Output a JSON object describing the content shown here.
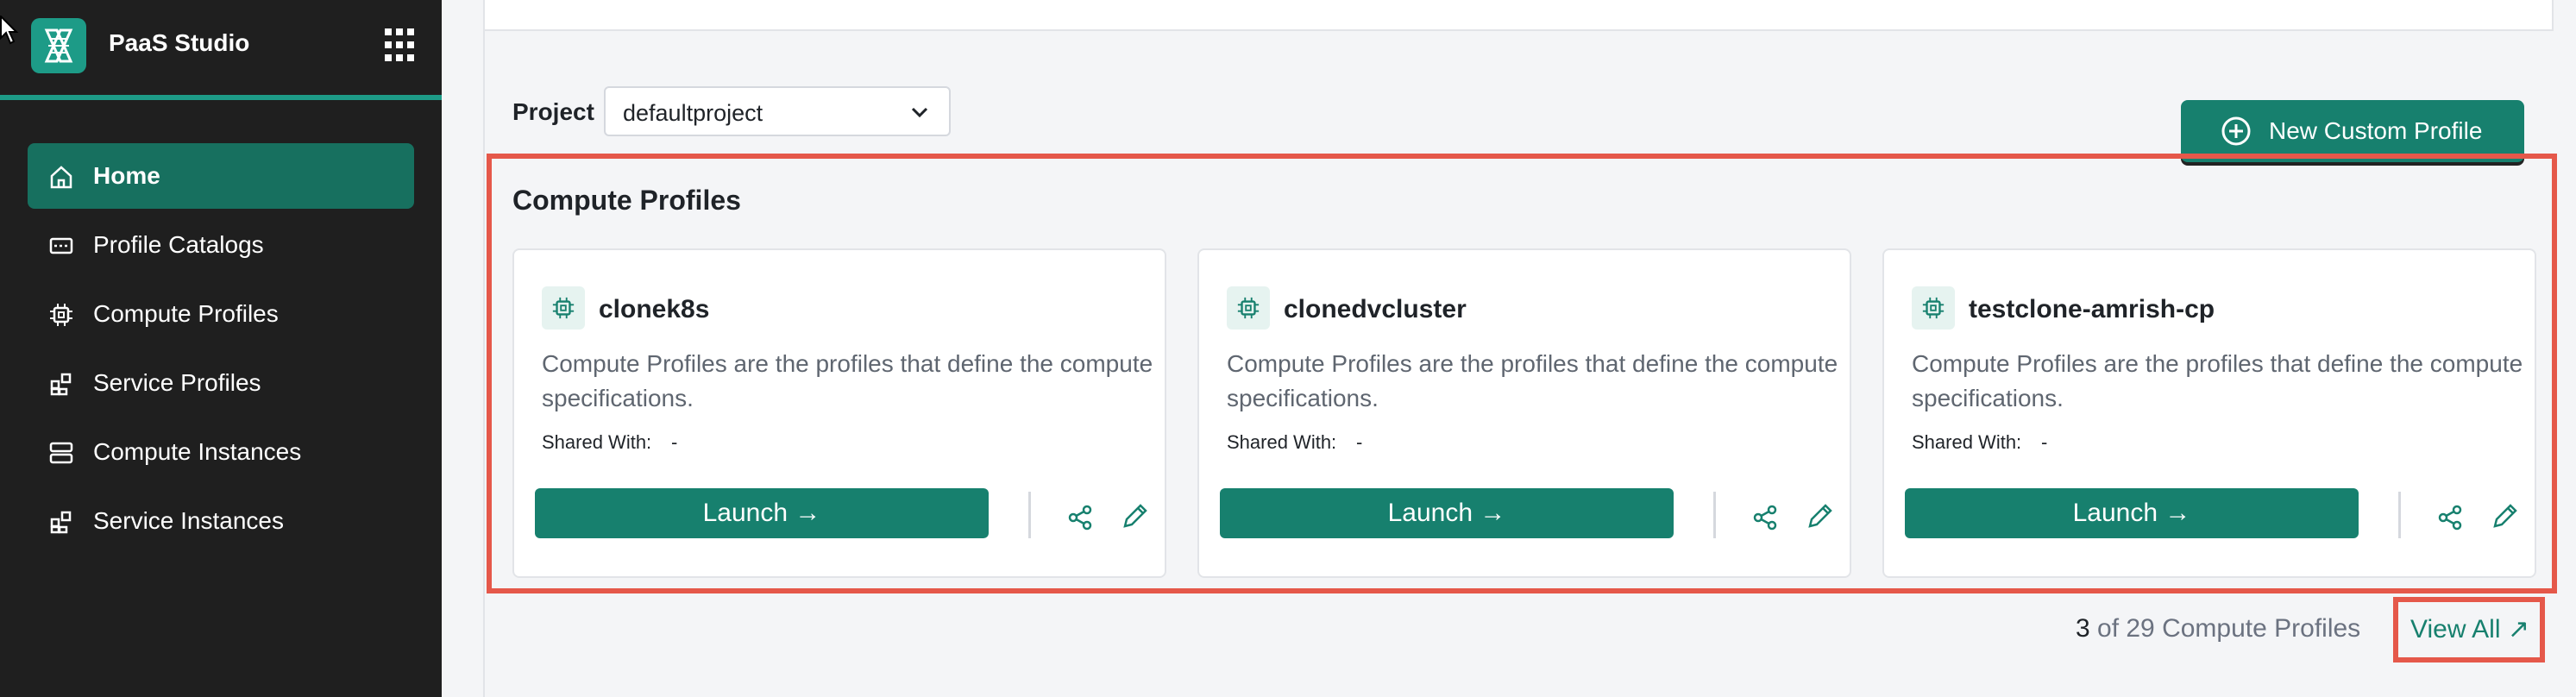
{
  "sidebar": {
    "app_name": "PaaS Studio",
    "items": [
      {
        "label": "Home",
        "icon": "home-icon",
        "active": true
      },
      {
        "label": "Profile Catalogs",
        "icon": "catalog-icon"
      },
      {
        "label": "Compute Profiles",
        "icon": "chip-icon"
      },
      {
        "label": "Service Profiles",
        "icon": "service-icon"
      },
      {
        "label": "Compute Instances",
        "icon": "server-icon"
      },
      {
        "label": "Service Instances",
        "icon": "service-icon"
      }
    ]
  },
  "toolbar": {
    "project_label": "Project",
    "project_value": "defaultproject",
    "new_button": "New Custom Profile"
  },
  "section": {
    "title": "Compute Profiles"
  },
  "cards": [
    {
      "name": "clonek8s",
      "description": "Compute Profiles are the profiles that define the compute specifications.",
      "shared_label": "Shared With:",
      "shared_value": "-",
      "launch": "Launch →"
    },
    {
      "name": "clonedvcluster",
      "description": "Compute Profiles are the profiles that define the compute specifications.",
      "shared_label": "Shared With:",
      "shared_value": "-",
      "launch": "Launch →"
    },
    {
      "name": "testclone-amrish-cp",
      "description": "Compute Profiles are the profiles that define the compute specifications.",
      "shared_label": "Shared With:",
      "shared_value": "-",
      "launch": "Launch →"
    }
  ],
  "footer": {
    "count": "3",
    "count_rest": " of 29 Compute Profiles",
    "view_all": "View All ↗"
  },
  "colors": {
    "accent": "#17806e",
    "highlight": "#e5584a",
    "sidebar_bg": "#1f1f1f"
  }
}
